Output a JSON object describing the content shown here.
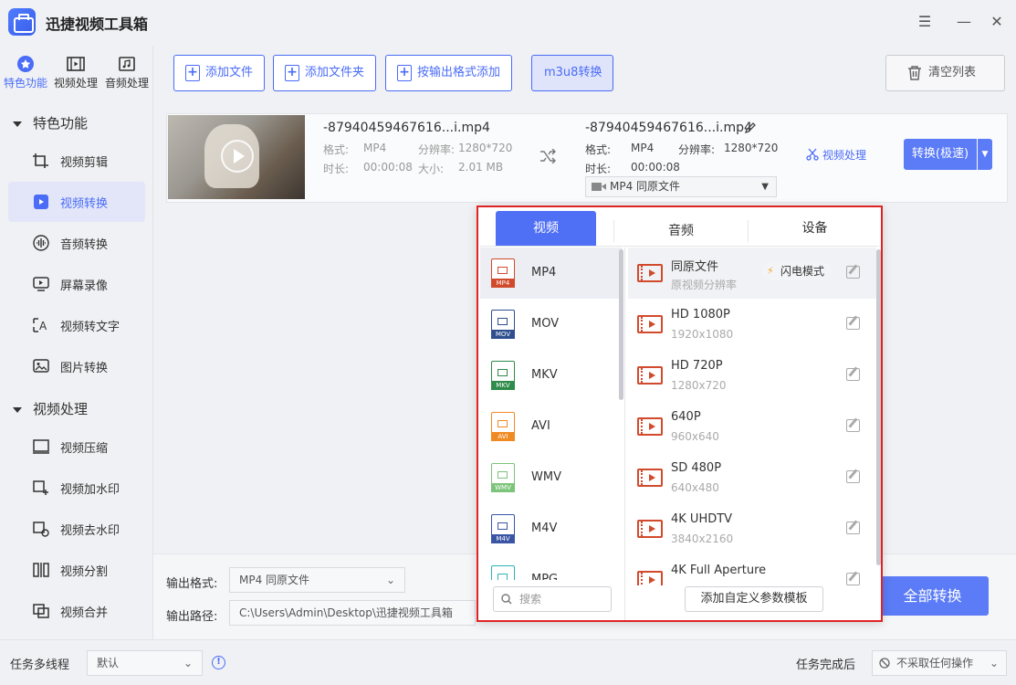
{
  "app": {
    "title": "迅捷视频工具箱"
  },
  "window": {
    "menu": "☰",
    "minimize": "—",
    "close": "✕"
  },
  "top_categories": [
    {
      "label": "特色功能",
      "icon": "star-icon",
      "active": true
    },
    {
      "label": "视频处理",
      "icon": "film-icon",
      "active": false
    },
    {
      "label": "音频处理",
      "icon": "music-icon",
      "active": false
    }
  ],
  "sidebar": {
    "section1": "特色功能",
    "section2": "视频处理",
    "items": [
      {
        "label": "视频剪辑",
        "icon": "crop-icon"
      },
      {
        "label": "视频转换",
        "icon": "video-convert-icon",
        "active": true
      },
      {
        "label": "音频转换",
        "icon": "audio-wave-icon"
      },
      {
        "label": "屏幕录像",
        "icon": "screen-record-icon"
      },
      {
        "label": "视频转文字",
        "icon": "video-to-text-icon"
      },
      {
        "label": "图片转换",
        "icon": "image-icon"
      },
      {
        "label": "视频压缩",
        "icon": "compress-icon"
      },
      {
        "label": "视频加水印",
        "icon": "add-watermark-icon"
      },
      {
        "label": "视频去水印",
        "icon": "remove-watermark-icon"
      },
      {
        "label": "视频分割",
        "icon": "split-icon"
      },
      {
        "label": "视频合并",
        "icon": "merge-icon"
      }
    ]
  },
  "toolbar": {
    "add_file": "添加文件",
    "add_folder": "添加文件夹",
    "add_by_format": "按输出格式添加",
    "m3u8": "m3u8转换",
    "clear_list": "清空列表"
  },
  "file": {
    "src_name": "-87940459467616...i.mp4",
    "src_format_label": "格式:",
    "src_format": "MP4",
    "src_res_label": "分辨率:",
    "src_res": "1280*720",
    "src_dur_label": "时长:",
    "src_dur": "00:00:08",
    "src_size_label": "大小:",
    "src_size": "2.01 MB",
    "out_name": "-87940459467616...i.mp4",
    "out_format_label": "格式:",
    "out_format": "MP4",
    "out_res_label": "分辨率:",
    "out_res": "1280*720",
    "out_dur_label": "时长:",
    "out_dur": "00:00:08",
    "out_select": "MP4  同原文件",
    "video_process": "视频处理",
    "convert": "转换(极速)"
  },
  "popup": {
    "tabs": [
      "视频",
      "音频",
      "设备"
    ],
    "formats": [
      {
        "label": "MP4",
        "tag": "MP4",
        "color": "#d24a2c",
        "active": true
      },
      {
        "label": "MOV",
        "tag": "MOV",
        "color": "#2f4f8f"
      },
      {
        "label": "MKV",
        "tag": "MKV",
        "color": "#2e8b4a"
      },
      {
        "label": "AVI",
        "tag": "AVI",
        "color": "#f08a24"
      },
      {
        "label": "WMV",
        "tag": "WMV",
        "color": "#7cc47a"
      },
      {
        "label": "M4V",
        "tag": "M4V",
        "color": "#3a55a5"
      },
      {
        "label": "MPG",
        "tag": "MPG",
        "color": "#2bb5b5"
      }
    ],
    "presets": [
      {
        "name": "同原文件",
        "res": "原视频分辨率",
        "active": true
      },
      {
        "name": "HD 1080P",
        "res": "1920x1080"
      },
      {
        "name": "HD 720P",
        "res": "1280x720"
      },
      {
        "name": "640P",
        "res": "960x640"
      },
      {
        "name": "SD 480P",
        "res": "640x480"
      },
      {
        "name": "4K UHDTV",
        "res": "3840x2160"
      },
      {
        "name": "4K Full Aperture",
        "res": ""
      }
    ],
    "flash_mode": "闪电模式",
    "search_placeholder": "搜索",
    "add_template": "添加自定义参数模板"
  },
  "bottom": {
    "output_format_label": "输出格式:",
    "output_format": "MP4  同原文件",
    "output_path_label": "输出路径:",
    "output_path": "C:\\Users\\Admin\\Desktop\\迅捷视频工具箱",
    "convert_all": "全部转换"
  },
  "status": {
    "multithread_label": "任务多线程",
    "multithread_value": "默认",
    "after_label": "任务完成后",
    "after_value": "不采取任何操作"
  }
}
